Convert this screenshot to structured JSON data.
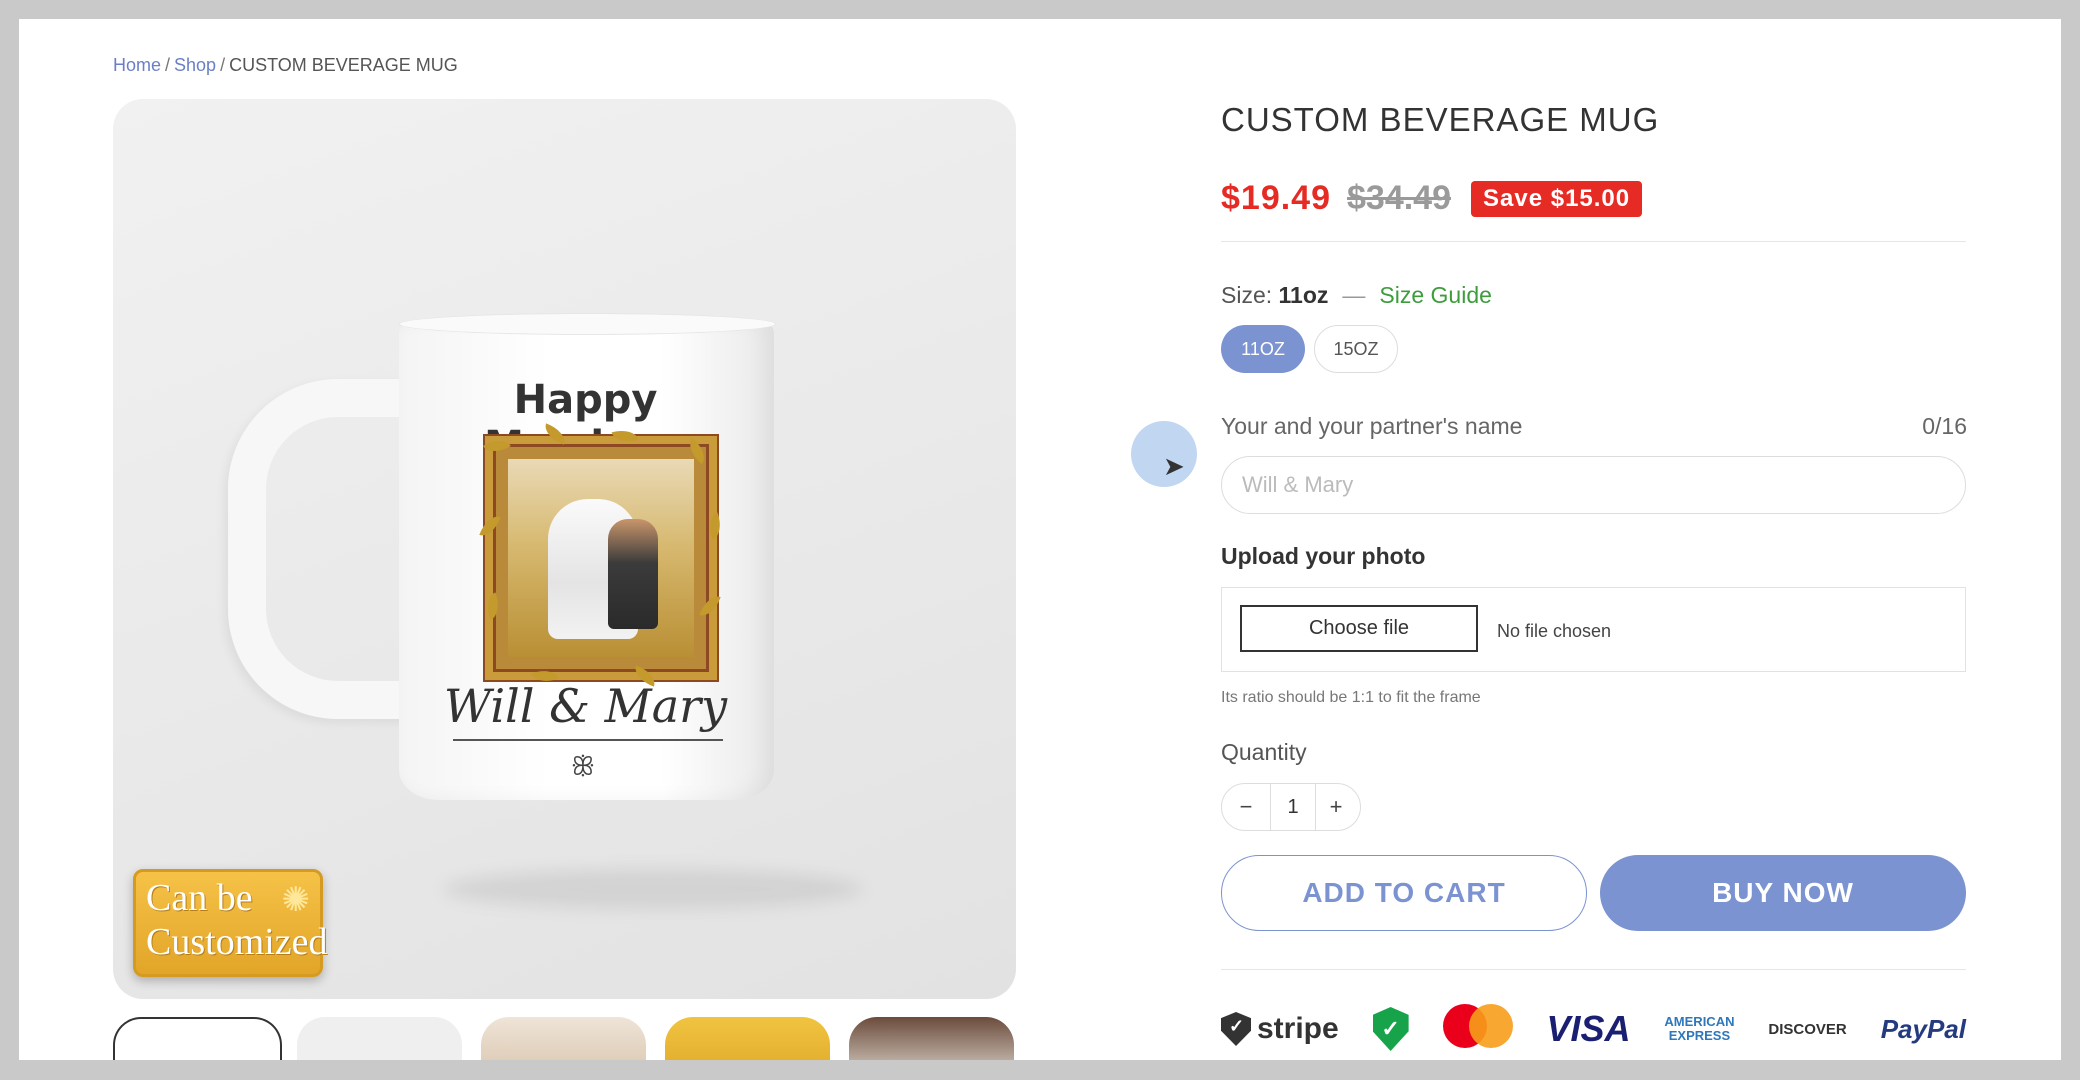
{
  "breadcrumb": {
    "home": "Home",
    "shop": "Shop",
    "sep": "/",
    "current": "CUSTOM BEVERAGE MUG"
  },
  "product": {
    "title": "CUSTOM BEVERAGE MUG",
    "price": "$19.49",
    "compare_price": "$34.49",
    "save_badge": "Save $15.00",
    "size_label": "Size:",
    "size_value": "11oz",
    "size_dash": "—",
    "size_guide": "Size Guide",
    "sizes": [
      "11OZ",
      "15OZ"
    ],
    "selected_size": "11OZ"
  },
  "gallery": {
    "mug_title": "Happy Marriage",
    "mug_names": "Will & Mary",
    "mug_ornament": "ꕥ",
    "badge_line1": "Can be",
    "badge_line2": "Customized",
    "badge_icon": "bulb-icon"
  },
  "personalize": {
    "name_label": "Your and your partner's name",
    "name_counter": "0/16",
    "name_placeholder": "Will & Mary",
    "upload_label": "Upload your photo",
    "file_button": "Choose file",
    "file_status": "No file chosen",
    "hint": "Its ratio should be 1:1 to fit the frame"
  },
  "quantity": {
    "label": "Quantity",
    "minus": "−",
    "value": "1",
    "plus": "+"
  },
  "actions": {
    "add_to_cart": "ADD TO CART",
    "buy_now": "BUY NOW"
  },
  "payments": {
    "stripe": "stripe",
    "ssl": "✓",
    "mastercard": "mastercard",
    "visa": "VISA",
    "amex_line1": "AMERICAN",
    "amex_line2": "EXPRESS",
    "discover": "DISCOVER",
    "paypal": "PayPal"
  },
  "colors": {
    "accent": "#7c93d1",
    "sale": "#e62b25",
    "guide": "#3d9d3d"
  }
}
